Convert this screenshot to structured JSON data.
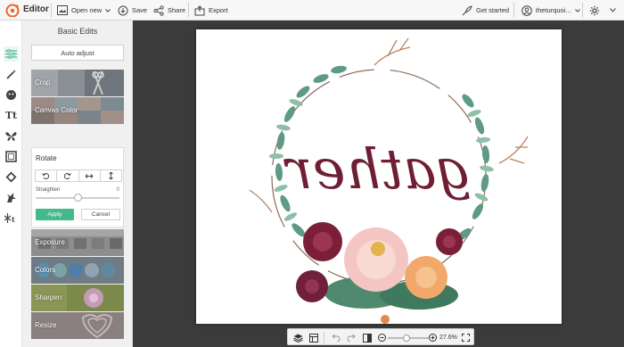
{
  "app": {
    "name": "Editor"
  },
  "toolbar": {
    "open_new": "Open new",
    "save": "Save",
    "share": "Share",
    "export": "Export",
    "get_started": "Get started",
    "account": "theturquoi..."
  },
  "panel": {
    "title": "Basic Edits",
    "auto_adjust": "Auto adjust",
    "tiles_top": [
      {
        "label": "Crop"
      },
      {
        "label": "Canvas Color"
      }
    ],
    "rotate": {
      "title": "Rotate",
      "straighten_label": "Straighten",
      "straighten_value": "0",
      "straighten_level": 0.5,
      "apply": "Apply",
      "cancel": "Cancel"
    },
    "tiles_bottom": [
      {
        "label": "Exposure"
      },
      {
        "label": "Colors"
      },
      {
        "label": "Sharpen"
      },
      {
        "label": "Resize"
      }
    ]
  },
  "artwork": {
    "text": "gather"
  },
  "zoom": {
    "value": "27.6%",
    "level": 0.45
  },
  "colors": {
    "accent": "#43b98d",
    "workspace": "#3b3b3b",
    "logo": "#f26522"
  }
}
